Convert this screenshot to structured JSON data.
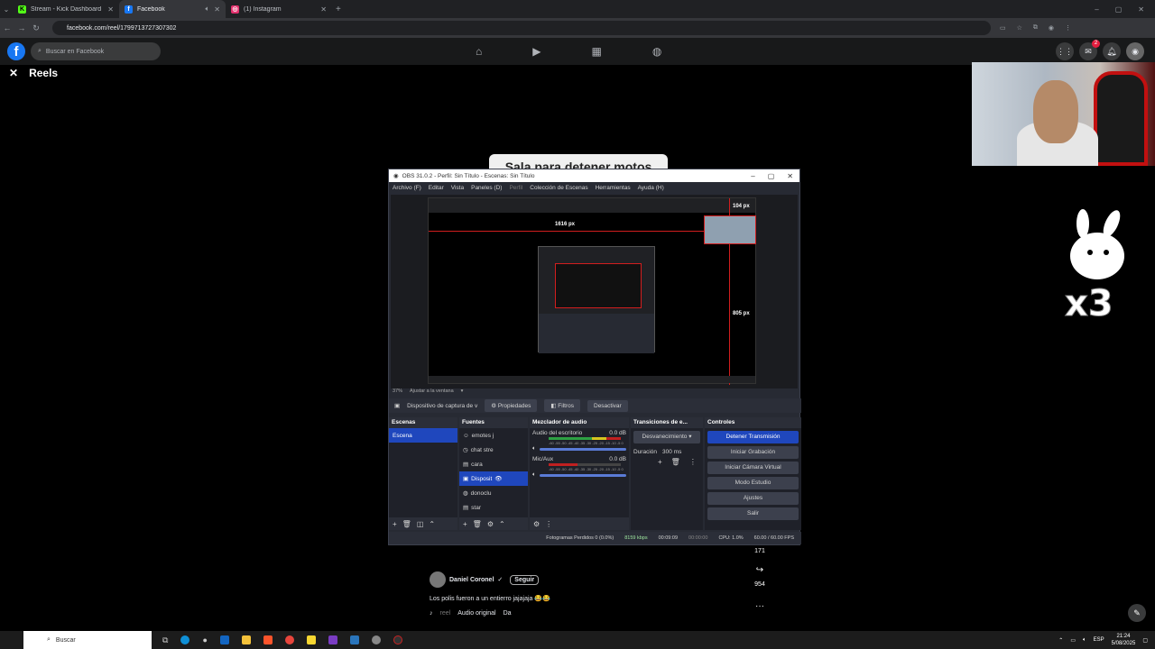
{
  "browser": {
    "tabs": [
      {
        "label": "Stream - Kick Dashboard",
        "favicon": "K",
        "color": "#53fc18"
      },
      {
        "label": "Facebook",
        "favicon": "f",
        "color": "#1877f2"
      },
      {
        "label": "(1) Instagram",
        "favicon": "◎",
        "color": "#e1306c"
      }
    ],
    "url": "facebook.com/reel/1799713727307302"
  },
  "facebook": {
    "search_placeholder": "Buscar en Facebook",
    "section_title": "Reels",
    "notifications_badge": "2",
    "overlay_text": "Sala para detener motos",
    "sticker_text": "x3"
  },
  "obs": {
    "window_title": "OBS 31.0.2 - Perfil: Sin Título - Escenas: Sin Título",
    "menu": [
      "Archivo (F)",
      "Editar",
      "Vista",
      "Paneles (D)",
      "Perfil",
      "Colección de Escenas",
      "Herramientas",
      "Ayuda (H)"
    ],
    "dimensions": {
      "width_label": "1616 px",
      "small_label": "104 px",
      "height_label": "805 px"
    },
    "zoom": "37%",
    "zoom_mode": "Ajustar a la ventana",
    "source_bar": {
      "selected": "Dispositivo de captura de v",
      "properties": "Propiedades",
      "filters": "Filtros",
      "deactivate": "Desactivar"
    },
    "scenes": {
      "title": "Escenas",
      "items": [
        "Escena"
      ]
    },
    "sources": {
      "title": "Fuentes",
      "items": [
        "emotes j",
        "chat stre",
        "cara",
        "Disposit",
        "donoclu",
        "star"
      ]
    },
    "mixer": {
      "title": "Mezclador de audio",
      "channels": [
        {
          "name": "Audio del escritorio",
          "db": "0.0 dB"
        },
        {
          "name": "Mic/Aux",
          "db": "0.0 dB"
        }
      ],
      "scale": "-60 -55 -50 -45 -40 -35 -30 -25 -20 -15 -10 -5 0"
    },
    "transitions": {
      "title": "Transiciones de e...",
      "type": "Desvanecimiento",
      "duration_label": "Duración",
      "duration": "300 ms"
    },
    "controls": {
      "title": "Controles",
      "buttons": [
        "Detener Transmisión",
        "Iniciar Grabación",
        "Iniciar Cámara Virtual",
        "Modo Estudio",
        "Ajustes",
        "Salir"
      ]
    },
    "status": {
      "dropped": "Fotogramas Perdidos 0 (0.0%)",
      "bitrate": "8159 kbps",
      "stream_time": "00:09:09",
      "rec_time": "00:00:00",
      "cpu": "CPU: 1.0%",
      "fps": "60.00 / 60.00 FPS"
    }
  },
  "reel": {
    "author": "Daniel Coronel",
    "follow": "Seguir",
    "caption": "Los polis fueron a un entierro jajajaja 😂😂",
    "audio_prefix": "reel",
    "audio": "Audio original",
    "audio_suffix": "Da",
    "comments_count": "171",
    "shares_count": "954"
  },
  "taskbar": {
    "search_placeholder": "Buscar",
    "language": "ESP",
    "time": "21:24",
    "date": "5/08/2025"
  }
}
